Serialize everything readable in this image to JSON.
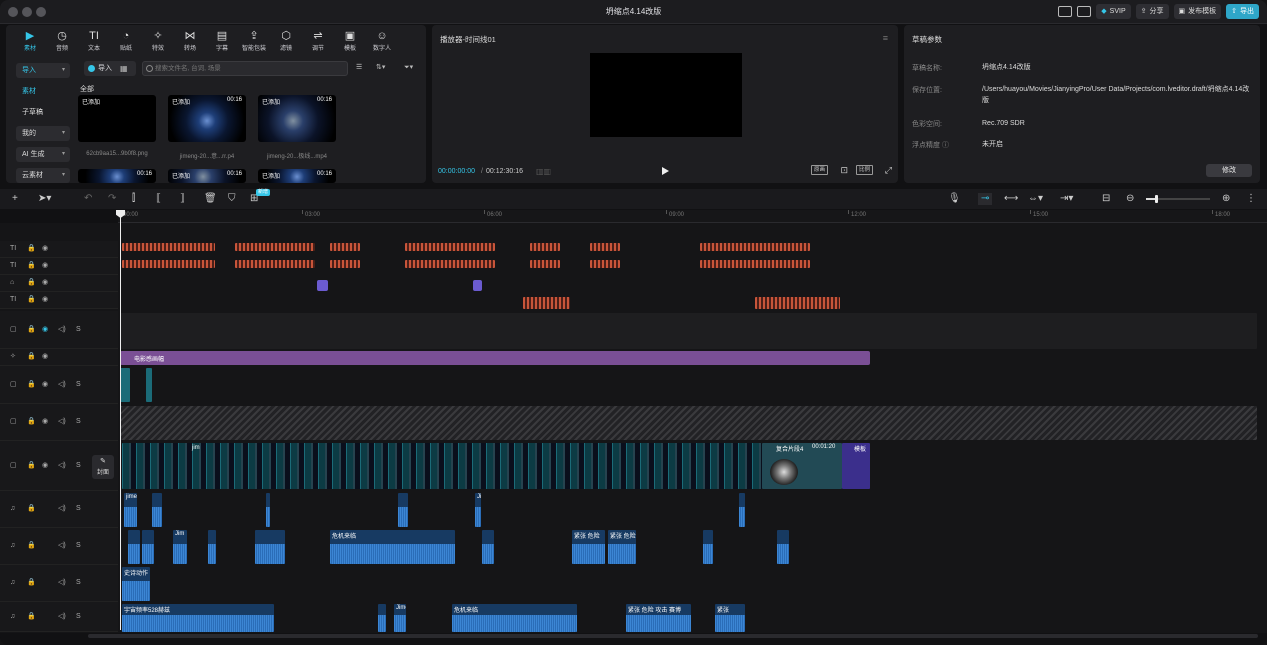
{
  "window": {
    "title": "坍缩点4.14改版",
    "buttons": {
      "svip": "SVIP",
      "share": "分享",
      "publish": "发布模板",
      "export": "导出"
    }
  },
  "toolbar": {
    "tools": [
      {
        "label": "素材",
        "icon": "media-icon"
      },
      {
        "label": "音频",
        "icon": "audio-icon"
      },
      {
        "label": "文本",
        "icon": "text-icon"
      },
      {
        "label": "贴纸",
        "icon": "sticker-icon"
      },
      {
        "label": "特效",
        "icon": "effects-icon"
      },
      {
        "label": "转场",
        "icon": "transition-icon"
      },
      {
        "label": "字幕",
        "icon": "subtitle-icon"
      },
      {
        "label": "智能包装",
        "icon": "smart-pack-icon"
      },
      {
        "label": "滤镜",
        "icon": "filter-icon"
      },
      {
        "label": "调节",
        "icon": "adjust-icon"
      },
      {
        "label": "模板",
        "icon": "template-icon"
      },
      {
        "label": "数字人",
        "icon": "avatar-icon"
      }
    ]
  },
  "sidebar": {
    "items": [
      "导入",
      "素材",
      "子草稿",
      "我的",
      "AI 生成",
      "云素材"
    ]
  },
  "media": {
    "import_label": "导入",
    "search_placeholder": "搜索文件名, 台词, 场景",
    "all_label": "全部",
    "items": [
      {
        "tag": "已添加",
        "duration": "",
        "name": "62cb9aa15...9b0f8.png"
      },
      {
        "tag": "已添加",
        "duration": "00:16",
        "name": "jimeng-20...意...rr.p4"
      },
      {
        "tag": "已添加",
        "duration": "00:16",
        "name": "jimeng-20...极线...mp4"
      },
      {
        "tag": "",
        "duration": "00:16",
        "name": ""
      },
      {
        "tag": "已添加",
        "duration": "00:16",
        "name": ""
      },
      {
        "tag": "已添加",
        "duration": "00:16",
        "name": ""
      }
    ]
  },
  "player": {
    "title": "播放器-时间线01",
    "current_time": "00:00:00:00",
    "total_time": "00:12:30:16",
    "ctl_original": "原画",
    "ctl_ratio": "比例"
  },
  "draft": {
    "title": "草稿参数",
    "rows": [
      {
        "label": "草稿名称:",
        "value": "坍缩点4.14改版"
      },
      {
        "label": "保存位置:",
        "value": "/Users/huayou/Movies/JianyingPro/User Data/Projects/com.lveditor.draft/坍缩点4.14改版"
      },
      {
        "label": "色彩空间:",
        "value": "Rec.709 SDR"
      },
      {
        "label": "浮点精度",
        "value": "未开启"
      }
    ],
    "modify_label": "修改"
  },
  "timeline": {
    "ruler": [
      "00:00",
      "03:00",
      "06:00",
      "09:00",
      "12:00",
      "15:00",
      "18:00"
    ],
    "badge": "新增",
    "effect_clip": "电影感画幅",
    "cover_label": "封面",
    "video_labels": [
      "jim",
      "复合片段4",
      "00:01:20",
      "模板"
    ],
    "audio_labels": [
      "jime",
      "Jim",
      "危机来临",
      "紧张 危险",
      "紧张 危险",
      "史诗动作",
      "宇宙频率528赫兹",
      "Jime",
      "危机来临",
      "紧张 危险 攻击 赛博",
      "紧张"
    ]
  },
  "colors": {
    "accent": "#35c6e8",
    "text_clip": "#c8553a",
    "effect": "#7a4f95",
    "audio": "#2a6db8"
  }
}
